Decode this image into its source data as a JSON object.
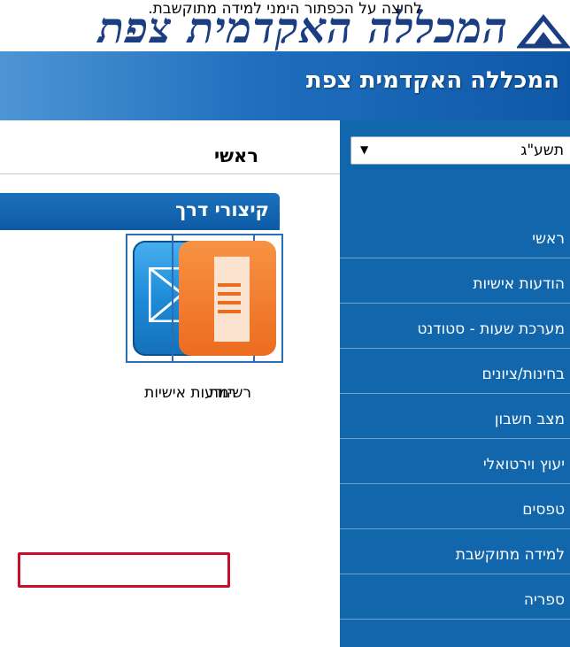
{
  "instruction": "לחיצה על הכפתור הימני למידה מתוקשבת.",
  "logo_text": "המכללה האקדמית צפת",
  "banner_title": "המכללה האקדמית צפת",
  "sidebar": {
    "year_select": "תשע\"ג",
    "items": [
      {
        "label": "ראשי"
      },
      {
        "label": "הודעות אישיות"
      },
      {
        "label": "מערכת שעות - סטודנט"
      },
      {
        "label": "בחינות/ציונים"
      },
      {
        "label": "מצב חשבון"
      },
      {
        "label": "יעוץ וירטואלי"
      },
      {
        "label": "טפסים"
      },
      {
        "label": "למידה מתוקשבת"
      },
      {
        "label": "ספריה"
      }
    ]
  },
  "main": {
    "page_heading": "ראשי",
    "shortcuts_label": "קיצורי דרך",
    "tiles": [
      {
        "label": "הודעות אישיות",
        "icon": "envelope-icon"
      },
      {
        "label": "רשימת",
        "icon": "document-list-icon"
      }
    ]
  },
  "colors": {
    "banner": "#0f58a8",
    "sidebar": "#1266ac",
    "highlight": "#c8102e",
    "tile_border": "#2a6fb6"
  }
}
